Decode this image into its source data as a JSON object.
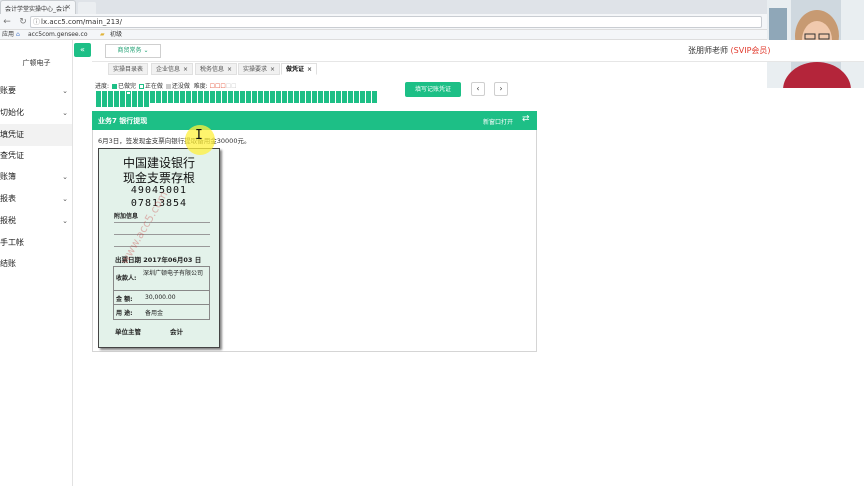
{
  "browser": {
    "tab_title": "会计学堂实操中心_会计",
    "url": "lx.acc5.com/main_213/",
    "bookmarks": [
      "应用",
      "acc5com.gensee.co",
      "初级"
    ]
  },
  "sidebar": {
    "company": "广顿电子",
    "items": [
      {
        "label": "账要",
        "chevron": true
      },
      {
        "label": "切始化",
        "chevron": true
      },
      {
        "label": "填凭证",
        "chevron": false,
        "active": true
      },
      {
        "label": "查凭证",
        "chevron": false
      },
      {
        "label": "账簿",
        "chevron": true
      },
      {
        "label": "报表",
        "chevron": true
      },
      {
        "label": "报税",
        "chevron": true
      },
      {
        "label": "手工帐",
        "chevron": false
      },
      {
        "label": "结账",
        "chevron": false
      }
    ]
  },
  "header": {
    "dropdown_label": "商贸常务",
    "teacher_name": "张朋师老师",
    "teacher_badge": "(SVIP会员)"
  },
  "tabs": [
    {
      "label": "实操目录表"
    },
    {
      "label": "企业信息"
    },
    {
      "label": "税务信息"
    },
    {
      "label": "实操要求"
    },
    {
      "label": "做凭证",
      "active": true
    }
  ],
  "progress": {
    "label": "进度:",
    "done_label": "已做完",
    "doing_label": "正在做",
    "todo_label": "还没做",
    "difficulty_label": "难度:",
    "total_cells": 150,
    "done_cells": 6
  },
  "buttons": {
    "fill_voucher": "填写记账凭证",
    "prev": "‹",
    "next": "›"
  },
  "task": {
    "title": "业务7 银行提现",
    "open_new_window": "新窗口打开",
    "description": "6月3日，签发现金支票向银行提取备用金30000元。"
  },
  "stub": {
    "bank": "中国建设银行",
    "title": "现金支票存根",
    "number_line1": "49045001",
    "number_line2": "07813854",
    "extra_info_label": "附加信息",
    "date_label": "出票日期",
    "date_value": "2017年06月03 日",
    "payee_label": "收款人:",
    "payee_value": "深圳广顿电子有限公司",
    "amount_label": "金    额:",
    "amount_value": "30,000.00",
    "purpose_label": "用    途:",
    "purpose_value": "备用金",
    "supervisor_label": "单位主管",
    "accountant_label": "会计",
    "watermark": "www.acc5.com"
  },
  "colors": {
    "accent": "#1dbf86",
    "svip": "#e23b2e",
    "stub_bg": "#e3f2ea"
  }
}
